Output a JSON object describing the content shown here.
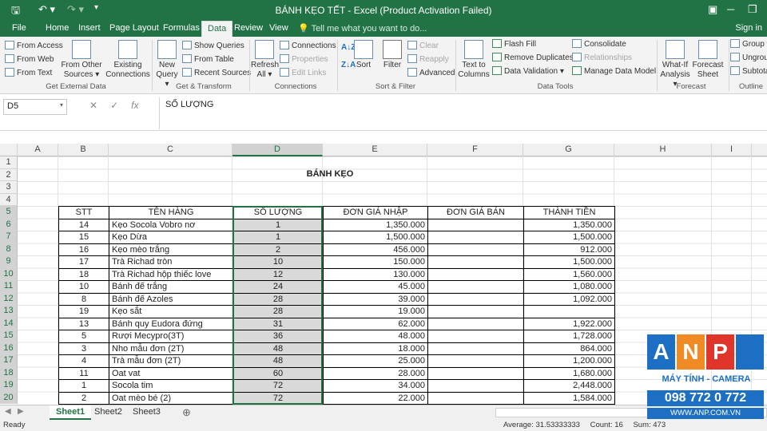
{
  "titlebar": {
    "title": "BÁNH KẸO TẾT  -  Excel (Product Activation Failed)",
    "save_icon": "save-icon",
    "undo_icon": "undo-icon",
    "redo_icon": "redo-icon"
  },
  "menu": {
    "tabs": [
      "File",
      "Home",
      "Insert",
      "Page Layout",
      "Formulas",
      "Data",
      "Review",
      "View"
    ],
    "active": "Data",
    "tell_me": "Tell me what you want to do...",
    "sign_in": "Sign in"
  },
  "ribbon": {
    "get_external": {
      "from_access": "From Access",
      "from_web": "From Web",
      "from_text": "From Text",
      "from_other": "From Other",
      "sources": "Sources ▾",
      "existing": "Existing",
      "connections": "Connections",
      "label": "Get External Data"
    },
    "get_transform": {
      "new": "New",
      "query": "Query ▾",
      "show_queries": "Show Queries",
      "from_table": "From Table",
      "recent_sources": "Recent Sources",
      "label": "Get & Transform"
    },
    "connections": {
      "refresh": "Refresh",
      "all": "All ▾",
      "connections": "Connections",
      "properties": "Properties",
      "edit_links": "Edit Links",
      "label": "Connections"
    },
    "sort_filter": {
      "sort": "Sort",
      "filter": "Filter",
      "clear": "Clear",
      "reapply": "Reapply",
      "advanced": "Advanced",
      "label": "Sort & Filter"
    },
    "data_tools": {
      "text_to": "Text to",
      "columns": "Columns",
      "flash_fill": "Flash Fill",
      "remove_duplicates": "Remove Duplicates",
      "data_validation": "Data Validation ▾",
      "consolidate": "Consolidate",
      "relationships": "Relationships",
      "manage_model": "Manage Data Model",
      "label": "Data Tools"
    },
    "forecast": {
      "whatif": "What-If",
      "analysis": "Analysis ▾",
      "forecast": "Forecast",
      "sheet": "Sheet",
      "label": "Forecast"
    },
    "outline": {
      "group": "Group ▾",
      "ungroup": "Ungroup",
      "subtotal": "Subtotal",
      "label": "Outline"
    }
  },
  "formula_bar": {
    "name_box": "D5",
    "cancel": "✕",
    "enter": "✓",
    "fx": "fx",
    "formula": "SỐ LƯỢNG"
  },
  "columns": [
    "A",
    "B",
    "C",
    "D",
    "E",
    "F",
    "G",
    "H",
    "I"
  ],
  "selected_column": "D",
  "rows": [
    "1",
    "2",
    "3",
    "4",
    "5",
    "6",
    "7",
    "8",
    "9",
    "10",
    "11",
    "12",
    "13",
    "14",
    "15",
    "16",
    "17",
    "18",
    "19",
    "20"
  ],
  "sheet": {
    "heading": "BÁNH KẸO",
    "headers": {
      "stt": "STT",
      "ten": "TÊN HÀNG",
      "sl": "SỐ LƯỢNG",
      "dgn": "ĐƠN GIÁ NHẬP",
      "dgb": "ĐƠN GIÁ BÁN",
      "tt": "THÀNH TIỀN"
    },
    "rows": [
      {
        "stt": "14",
        "ten": "Kẹo Socola Vobro nơ",
        "sl": "1",
        "dgn": "1,350.000",
        "dgb": "",
        "tt": "1,350.000"
      },
      {
        "stt": "15",
        "ten": "Kẹo Dừa",
        "sl": "1",
        "dgn": "1,500.000",
        "dgb": "",
        "tt": "1,500.000"
      },
      {
        "stt": "16",
        "ten": "Kẹo mèo trắng",
        "sl": "2",
        "dgn": "456.000",
        "dgb": "",
        "tt": "912.000"
      },
      {
        "stt": "17",
        "ten": "Trà Richad tròn",
        "sl": "10",
        "dgn": "150.000",
        "dgb": "",
        "tt": "1,500.000"
      },
      {
        "stt": "18",
        "ten": "Trà Richad hộp thiếc love",
        "sl": "12",
        "dgn": "130.000",
        "dgb": "",
        "tt": "1,560.000"
      },
      {
        "stt": "10",
        "ten": "Bánh đế trắng",
        "sl": "24",
        "dgn": "45.000",
        "dgb": "",
        "tt": "1,080.000"
      },
      {
        "stt": "8",
        "ten": "Bánh đế Azoles",
        "sl": "28",
        "dgn": "39.000",
        "dgb": "",
        "tt": "1,092.000"
      },
      {
        "stt": "19",
        "ten": "Kẹo sắt",
        "sl": "28",
        "dgn": "19.000",
        "dgb": "",
        "tt": ""
      },
      {
        "stt": "13",
        "ten": "Bánh quy Eudora đứng",
        "sl": "31",
        "dgn": "62.000",
        "dgb": "",
        "tt": "1,922.000"
      },
      {
        "stt": "5",
        "ten": "Rượi Mecypro(3T)",
        "sl": "36",
        "dgn": "48.000",
        "dgb": "",
        "tt": "1,728.000"
      },
      {
        "stt": "3",
        "ten": "Nho mẫu đơn (2T)",
        "sl": "48",
        "dgn": "18.000",
        "dgb": "",
        "tt": "864.000"
      },
      {
        "stt": "4",
        "ten": "Trà mẫu đơn (2T)",
        "sl": "48",
        "dgn": "25.000",
        "dgb": "",
        "tt": "1,200.000"
      },
      {
        "stt": "11",
        "ten": "Oat vat",
        "sl": "60",
        "dgn": "28.000",
        "dgb": "",
        "tt": "1,680.000"
      },
      {
        "stt": "1",
        "ten": "Socola tim",
        "sl": "72",
        "dgn": "34.000",
        "dgb": "",
        "tt": "2,448.000"
      },
      {
        "stt": "2",
        "ten": "Oat mèo bé (2)",
        "sl": "72",
        "dgn": "22.000",
        "dgb": "",
        "tt": "1,584.000"
      }
    ]
  },
  "sheet_tabs": {
    "tabs": [
      "Sheet1",
      "Sheet2",
      "Sheet3"
    ],
    "active": "Sheet1",
    "add": "⊕"
  },
  "status": {
    "ready": "Ready",
    "average": "Average: 31.53333333",
    "count": "Count: 16",
    "sum": "Sum: 473"
  },
  "watermark": {
    "letters": [
      "A",
      "N",
      "P"
    ],
    "subtitle": "MÁY TÍNH - CAMERA",
    "phone": "098 772 0 772",
    "web": "WWW.ANP.COM.VN",
    "colors": [
      "#1d6fc4",
      "#f08a24",
      "#e0352b"
    ]
  }
}
